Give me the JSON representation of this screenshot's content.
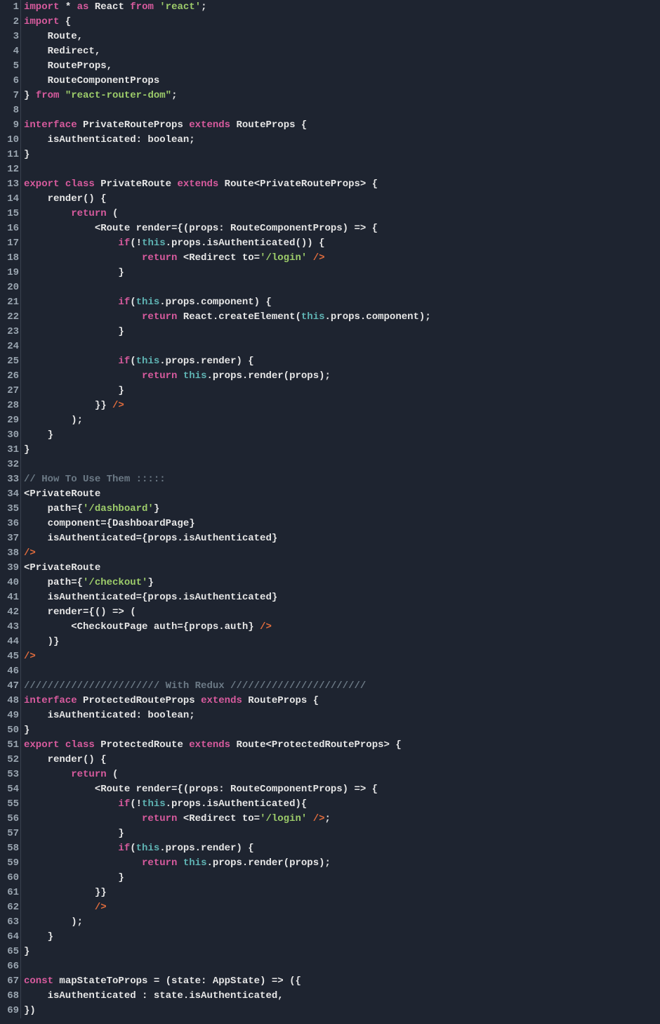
{
  "lines": [
    [
      [
        "kw",
        "import"
      ],
      [
        "id",
        " * "
      ],
      [
        "kw",
        "as"
      ],
      [
        "id",
        " React "
      ],
      [
        "kw",
        "from"
      ],
      [
        "id",
        " "
      ],
      [
        "str",
        "'react'"
      ],
      [
        "id",
        ";"
      ]
    ],
    [
      [
        "kw",
        "import"
      ],
      [
        "id",
        " {"
      ]
    ],
    [
      [
        "id",
        "    Route,"
      ]
    ],
    [
      [
        "id",
        "    Redirect,"
      ]
    ],
    [
      [
        "id",
        "    RouteProps,"
      ]
    ],
    [
      [
        "id",
        "    RouteComponentProps"
      ]
    ],
    [
      [
        "id",
        "} "
      ],
      [
        "kw",
        "from"
      ],
      [
        "id",
        " "
      ],
      [
        "str",
        "\"react-router-dom\""
      ],
      [
        "id",
        ";"
      ]
    ],
    [
      [
        "id",
        ""
      ]
    ],
    [
      [
        "kw",
        "interface"
      ],
      [
        "id",
        " PrivateRouteProps "
      ],
      [
        "kw",
        "extends"
      ],
      [
        "id",
        " RouteProps {"
      ]
    ],
    [
      [
        "id",
        "    isAuthenticated: boolean;"
      ]
    ],
    [
      [
        "id",
        "}"
      ]
    ],
    [
      [
        "id",
        ""
      ]
    ],
    [
      [
        "kw",
        "export"
      ],
      [
        "id",
        " "
      ],
      [
        "kw",
        "class"
      ],
      [
        "id",
        " PrivateRoute "
      ],
      [
        "kw",
        "extends"
      ],
      [
        "id",
        " Route<PrivateRouteProps> {"
      ]
    ],
    [
      [
        "id",
        "    render() {"
      ]
    ],
    [
      [
        "id",
        "        "
      ],
      [
        "kw",
        "return"
      ],
      [
        "id",
        " ("
      ]
    ],
    [
      [
        "id",
        "            <Route render={(props: RouteComponentProps) => {"
      ]
    ],
    [
      [
        "id",
        "                "
      ],
      [
        "kw",
        "if"
      ],
      [
        "id",
        "(!"
      ],
      [
        "this",
        "this"
      ],
      [
        "id",
        ".props.isAuthenticated()) {"
      ]
    ],
    [
      [
        "id",
        "                    "
      ],
      [
        "kw",
        "return"
      ],
      [
        "id",
        " <Redirect to="
      ],
      [
        "str",
        "'/login'"
      ],
      [
        "id",
        " "
      ],
      [
        "tag",
        "/>"
      ]
    ],
    [
      [
        "id",
        "                }"
      ]
    ],
    [
      [
        "id",
        ""
      ]
    ],
    [
      [
        "id",
        "                "
      ],
      [
        "kw",
        "if"
      ],
      [
        "id",
        "("
      ],
      [
        "this",
        "this"
      ],
      [
        "id",
        ".props.component) {"
      ]
    ],
    [
      [
        "id",
        "                    "
      ],
      [
        "kw",
        "return"
      ],
      [
        "id",
        " React.createElement("
      ],
      [
        "this",
        "this"
      ],
      [
        "id",
        ".props.component);"
      ]
    ],
    [
      [
        "id",
        "                }"
      ]
    ],
    [
      [
        "id",
        ""
      ]
    ],
    [
      [
        "id",
        "                "
      ],
      [
        "kw",
        "if"
      ],
      [
        "id",
        "("
      ],
      [
        "this",
        "this"
      ],
      [
        "id",
        ".props.render) {"
      ]
    ],
    [
      [
        "id",
        "                    "
      ],
      [
        "kw",
        "return"
      ],
      [
        "id",
        " "
      ],
      [
        "this",
        "this"
      ],
      [
        "id",
        ".props.render(props);"
      ]
    ],
    [
      [
        "id",
        "                }"
      ]
    ],
    [
      [
        "id",
        "            }} "
      ],
      [
        "tag",
        "/>"
      ]
    ],
    [
      [
        "id",
        "        );"
      ]
    ],
    [
      [
        "id",
        "    }"
      ]
    ],
    [
      [
        "id",
        "}"
      ]
    ],
    [
      [
        "id",
        ""
      ]
    ],
    [
      [
        "cmt",
        "// How To Use Them :::::"
      ]
    ],
    [
      [
        "id",
        "<PrivateRoute"
      ]
    ],
    [
      [
        "id",
        "    path={"
      ],
      [
        "str",
        "'/dashboard'"
      ],
      [
        "id",
        "}"
      ]
    ],
    [
      [
        "id",
        "    component={DashboardPage}"
      ]
    ],
    [
      [
        "id",
        "    isAuthenticated={props.isAuthenticated}"
      ]
    ],
    [
      [
        "tag",
        "/>"
      ]
    ],
    [
      [
        "id",
        "<PrivateRoute"
      ]
    ],
    [
      [
        "id",
        "    path={"
      ],
      [
        "str",
        "'/checkout'"
      ],
      [
        "id",
        "}"
      ]
    ],
    [
      [
        "id",
        "    isAuthenticated={props.isAuthenticated}"
      ]
    ],
    [
      [
        "id",
        "    render={() => ("
      ]
    ],
    [
      [
        "id",
        "        <CheckoutPage auth={props.auth} "
      ],
      [
        "tag",
        "/>"
      ]
    ],
    [
      [
        "id",
        "    )}"
      ]
    ],
    [
      [
        "tag",
        "/>"
      ]
    ],
    [
      [
        "id",
        ""
      ]
    ],
    [
      [
        "cmt",
        "/////////////////////// With Redux ///////////////////////"
      ]
    ],
    [
      [
        "kw",
        "interface"
      ],
      [
        "id",
        " ProtectedRouteProps "
      ],
      [
        "kw",
        "extends"
      ],
      [
        "id",
        " RouteProps {"
      ]
    ],
    [
      [
        "id",
        "    isAuthenticated: boolean;"
      ]
    ],
    [
      [
        "id",
        "}"
      ]
    ],
    [
      [
        "kw",
        "export"
      ],
      [
        "id",
        " "
      ],
      [
        "kw",
        "class"
      ],
      [
        "id",
        " ProtectedRoute "
      ],
      [
        "kw",
        "extends"
      ],
      [
        "id",
        " Route<ProtectedRouteProps> {"
      ]
    ],
    [
      [
        "id",
        "    render() {"
      ]
    ],
    [
      [
        "id",
        "        "
      ],
      [
        "kw",
        "return"
      ],
      [
        "id",
        " ("
      ]
    ],
    [
      [
        "id",
        "            <Route render={(props: RouteComponentProps) => {"
      ]
    ],
    [
      [
        "id",
        "                "
      ],
      [
        "kw",
        "if"
      ],
      [
        "id",
        "(!"
      ],
      [
        "this",
        "this"
      ],
      [
        "id",
        ".props.isAuthenticated){"
      ]
    ],
    [
      [
        "id",
        "                    "
      ],
      [
        "kw",
        "return"
      ],
      [
        "id",
        " <Redirect to="
      ],
      [
        "str",
        "'/login'"
      ],
      [
        "id",
        " "
      ],
      [
        "tag",
        "/>"
      ],
      [
        "id",
        ";"
      ]
    ],
    [
      [
        "id",
        "                }"
      ]
    ],
    [
      [
        "id",
        "                "
      ],
      [
        "kw",
        "if"
      ],
      [
        "id",
        "("
      ],
      [
        "this",
        "this"
      ],
      [
        "id",
        ".props.render) {"
      ]
    ],
    [
      [
        "id",
        "                    "
      ],
      [
        "kw",
        "return"
      ],
      [
        "id",
        " "
      ],
      [
        "this",
        "this"
      ],
      [
        "id",
        ".props.render(props);"
      ]
    ],
    [
      [
        "id",
        "                }"
      ]
    ],
    [
      [
        "id",
        "            }}"
      ]
    ],
    [
      [
        "id",
        "            "
      ],
      [
        "tag",
        "/>"
      ]
    ],
    [
      [
        "id",
        "        );"
      ]
    ],
    [
      [
        "id",
        "    }"
      ]
    ],
    [
      [
        "id",
        "}"
      ]
    ],
    [
      [
        "id",
        ""
      ]
    ],
    [
      [
        "kw",
        "const"
      ],
      [
        "id",
        " mapStateToProps = (state: AppState) => ({"
      ]
    ],
    [
      [
        "id",
        "    isAuthenticated : state.isAuthenticated,"
      ]
    ],
    [
      [
        "id",
        "})"
      ]
    ]
  ]
}
